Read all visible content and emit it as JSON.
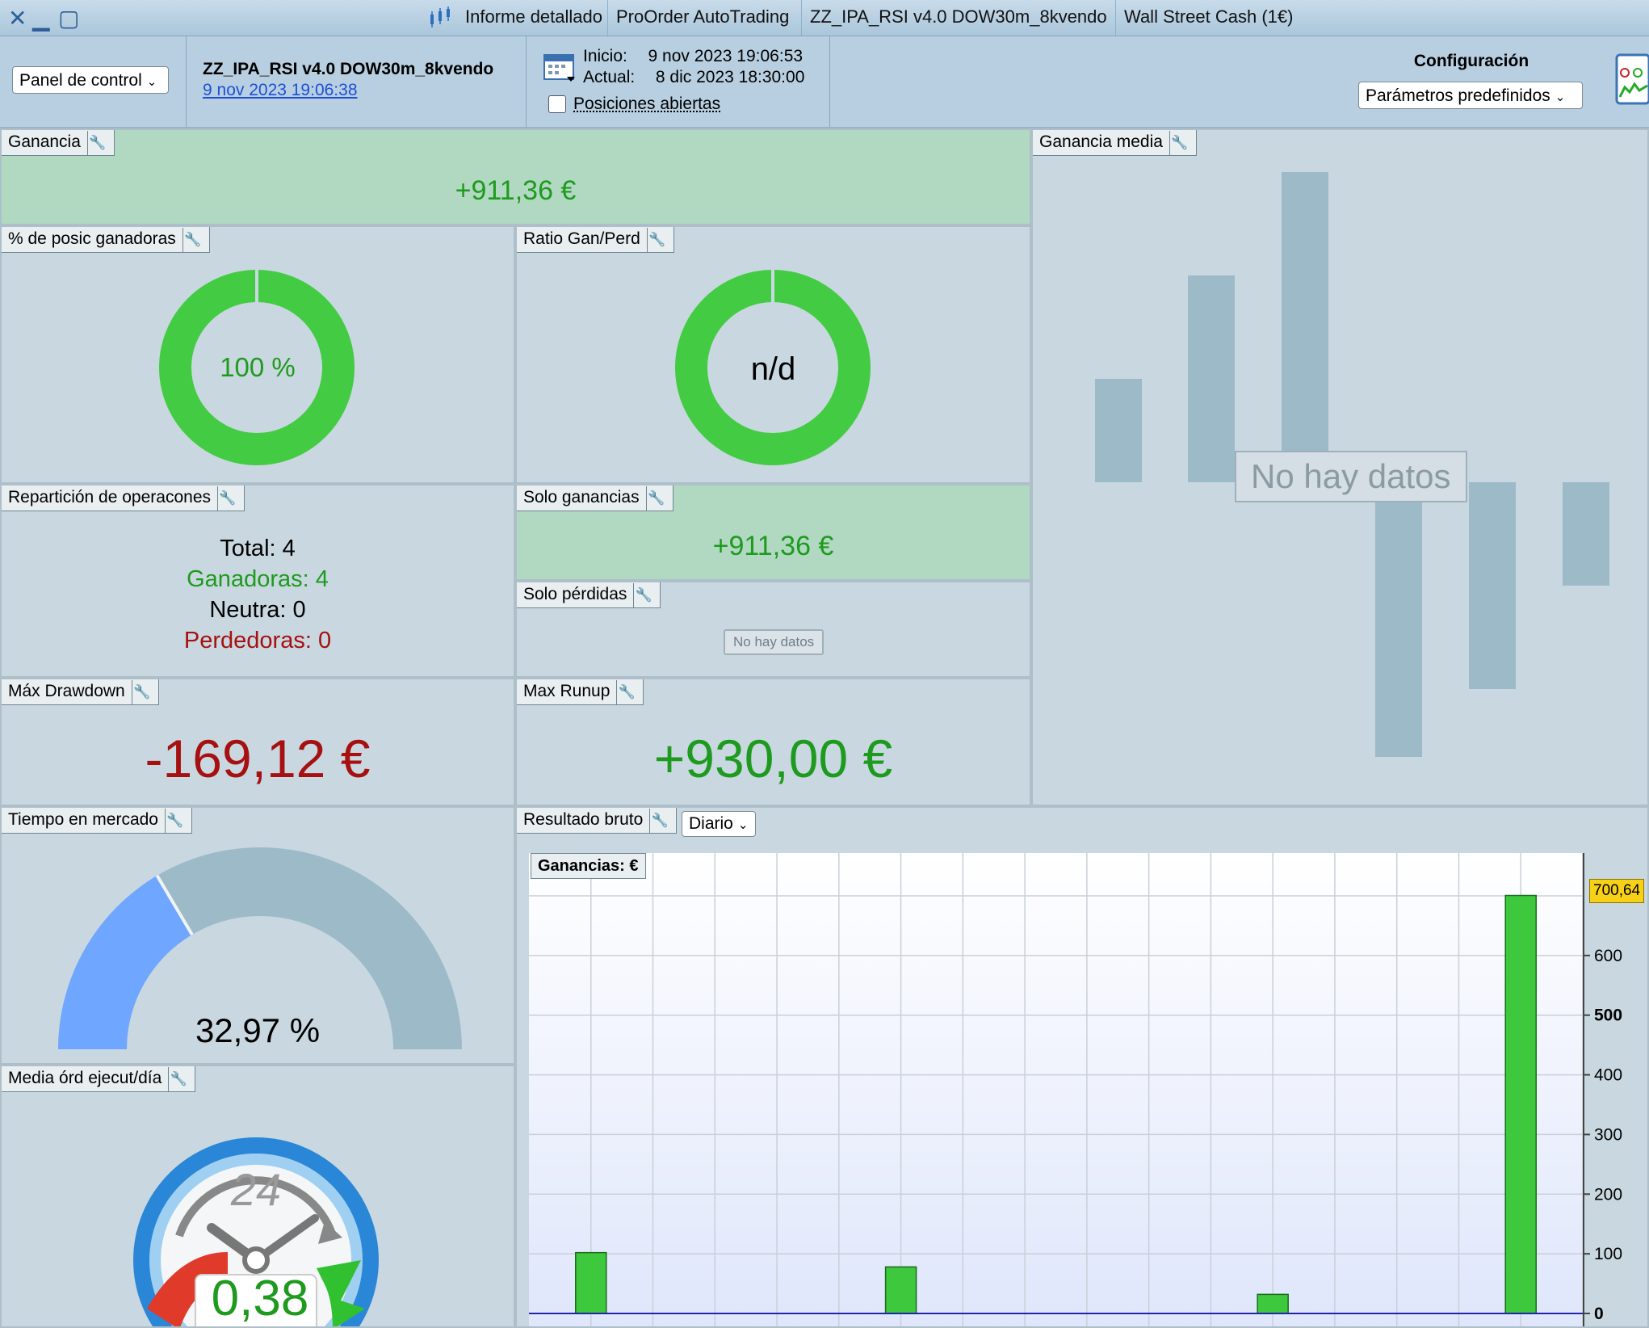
{
  "titlebar": {
    "tabs": [
      "Informe detallado",
      "ProOrder AutoTrading",
      "ZZ_IPA_RSI v4.0 DOW30m_8kvendo",
      "Wall Street Cash (1€)"
    ]
  },
  "toolbar": {
    "panel_select": "Panel de control",
    "strategy_name": "ZZ_IPA_RSI v4.0 DOW30m_8kvendo",
    "strategy_date_link": "9 nov 2023 19:06:38",
    "inicio_label": "Inicio:",
    "inicio_value": "9 nov 2023 19:06:53",
    "actual_label": "Actual:",
    "actual_value": "8 dic 2023 18:30:00",
    "open_positions_label": "Posiciones abiertas",
    "config_label": "Configuración",
    "params_select": "Parámetros predefinidos"
  },
  "panels": {
    "ganancia": {
      "title": "Ganancia",
      "value": "+911,36 €"
    },
    "ganadoras_pct": {
      "title": "% de posic ganadoras",
      "value": "100 %",
      "fraction": 1.0
    },
    "ratio": {
      "title": "Ratio Gan/Perd",
      "value": "n/d",
      "fraction": 1.0
    },
    "ganancia_media": {
      "title": "Ganancia media",
      "nodata": "No hay datos"
    },
    "reparticion": {
      "title": "Repartición de operacones",
      "total": "Total: 4",
      "ganadoras": "Ganadoras: 4",
      "neutra": "Neutra: 0",
      "perdedoras": "Perdedoras: 0"
    },
    "solo_ganancias": {
      "title": "Solo ganancias",
      "value": "+911,36 €"
    },
    "solo_perdidas": {
      "title": "Solo pérdidas",
      "nodata": "No hay datos"
    },
    "max_drawdown": {
      "title": "Máx Drawdown",
      "value": "-169,12 €"
    },
    "max_runup": {
      "title": "Max Runup",
      "value": "+930,00 €"
    },
    "tiempo_mercado": {
      "title": "Tiempo en mercado",
      "value": "32,97 %",
      "fraction": 0.3297
    },
    "media_ord": {
      "title": "Media órd ejecut/día",
      "value": "0,38",
      "clock_label": "24"
    },
    "resultado_bruto": {
      "title": "Resultado bruto",
      "period_select": "Diario"
    }
  },
  "chart_data": {
    "type": "bar",
    "title": "Ganancias: €",
    "y_ticks": [
      "0",
      "100",
      "200",
      "300",
      "400",
      "500",
      "600"
    ],
    "ylim": [
      0,
      700
    ],
    "last_value_label": "700,64",
    "bars": [
      {
        "slot": 1,
        "value": 102
      },
      {
        "slot": 6,
        "value": 78
      },
      {
        "slot": 12,
        "value": 32
      },
      {
        "slot": 16,
        "value": 700.64
      }
    ],
    "grid": true
  }
}
